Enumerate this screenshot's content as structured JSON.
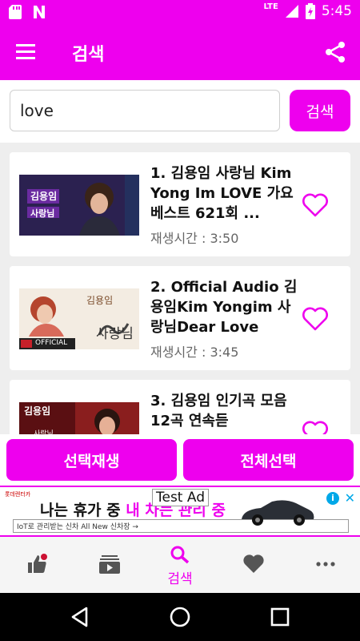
{
  "status_bar": {
    "network": "LTE",
    "time": "5:45"
  },
  "toolbar": {
    "title": "검색"
  },
  "search": {
    "value": "love",
    "button_label": "검색"
  },
  "results": [
    {
      "title": "1. 김용임 사랑님 Kim Yong Im LOVE 가요베스트 621회 ...",
      "duration": "재생시간 : 3:50",
      "thumb_caption": "김용임",
      "thumb_subcaption": "사랑님"
    },
    {
      "title": "2. Official Audio 김용임Kim Yongim 사랑님Dear Love",
      "duration": "재생시간 : 3:45",
      "thumb_caption": "김용임",
      "thumb_subcaption": "사랑님",
      "thumb_badge": "OFFICIAL"
    },
    {
      "title": "3. 김용임 인기곡 모음 12곡 연속듣",
      "duration": "",
      "thumb_caption": "김용임",
      "thumb_subcaption": "사랑님"
    }
  ],
  "actions": {
    "select_play": "선택재생",
    "select_all": "전체선택"
  },
  "ad": {
    "label": "Test Ad",
    "headline_dark": "나는 휴가 중 ",
    "headline_pink": "내 차는 관리 중",
    "subline": "IoT로 관리받는 신차 All New 신차장 →"
  },
  "bottom_nav": {
    "search_label": "검색"
  },
  "colors": {
    "accent": "#ee00ee",
    "background": "#eeeeee"
  }
}
